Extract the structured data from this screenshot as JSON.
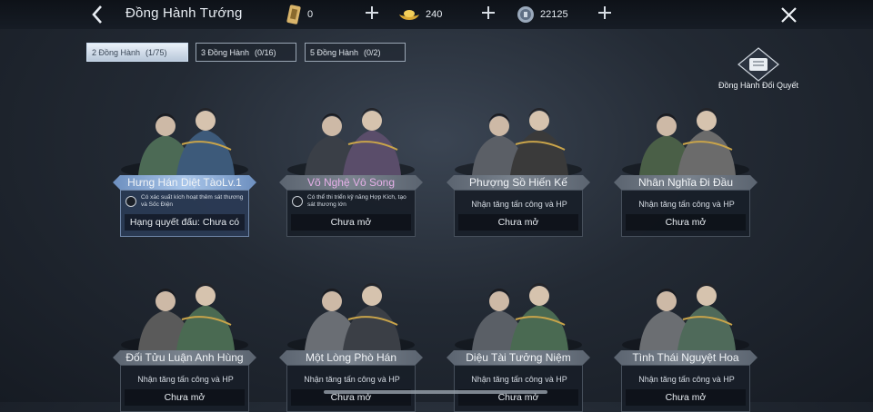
{
  "header": {
    "title": "Đồng Hành Tướng"
  },
  "resources": [
    {
      "icon": "token-icon",
      "value": "0"
    },
    {
      "icon": "gold-ingot-icon",
      "value": "240"
    },
    {
      "icon": "silver-coin-icon",
      "value": "22125"
    }
  ],
  "tabs": [
    {
      "label": "2 Đồng Hành",
      "count": "(1/75)",
      "active": true
    },
    {
      "label": "3 Đồng Hành",
      "count": "(0/16)",
      "active": false
    },
    {
      "label": "5 Đồng Hành",
      "count": "(0/2)",
      "active": false
    }
  ],
  "duel": {
    "label": "Đồng Hành Đối Quyết"
  },
  "cards": [
    {
      "name": "Hưng Hán Diệt TàoLv.1",
      "skill": "Có xác suất kích hoạt thêm sát thương và Sốc Điện",
      "stat": "Hạng quyết đấu: Chưa có",
      "highlight": true
    },
    {
      "name": "Võ Nghệ Vô Song",
      "skill": "Có thể thi triển kỹ năng Hợp Kích, tạo sát thương lớn",
      "stat": "Chưa mở",
      "name_color": "#e6b0e8"
    },
    {
      "name": "Phượng Sồ Hiến Kế",
      "desc": "Nhận tăng tấn công và HP",
      "stat": "Chưa mở"
    },
    {
      "name": "Nhân Nghĩa Đi Đầu",
      "desc": "Nhận tăng tấn công và HP",
      "stat": "Chưa mở"
    },
    {
      "name": "Đối Tửu Luận Anh Hùng",
      "desc": "Nhận tăng tấn công và HP",
      "stat": "Chưa mở"
    },
    {
      "name": "Một Lòng Phò Hán",
      "desc": "Nhận tăng tấn công và HP",
      "stat": "Chưa mở"
    },
    {
      "name": "Diệu Tài Tưởng Niệm",
      "desc": "Nhận tăng tấn công và HP",
      "stat": "Chưa mở"
    },
    {
      "name": "Tình Thái Nguyệt Hoa",
      "desc": "Nhận tăng tấn công và HP",
      "stat": "Chưa mở"
    }
  ],
  "colors": {
    "accent_blue": "#9fc3f0",
    "panel_dark": "#181e28",
    "highlight_panel": "#2a3a54"
  }
}
